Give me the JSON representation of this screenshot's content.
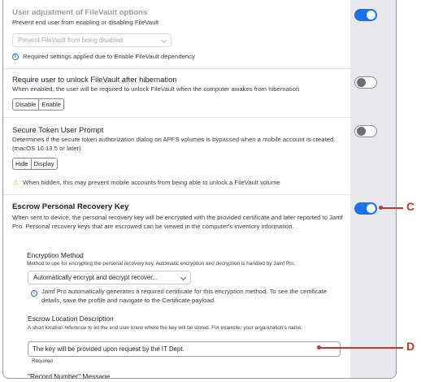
{
  "filevault_adjust": {
    "title": "User adjustment of FileVault options",
    "description": "Prevent end user from enabling or disabling FileVault",
    "select_value": "Prevent FileVault from being disabled",
    "note": "Required settings applied due to Enable FileVault dependency",
    "toggle": "on"
  },
  "unlock_hibernation": {
    "title": "Require user to unlock FileVault after hibernation",
    "description": "When enabled, the user will be required to unlock FileVault when the computer awakes from hibernation",
    "options": [
      "Disable",
      "Enable"
    ],
    "toggle": "off"
  },
  "secure_token": {
    "title": "Secure Token User Prompt",
    "description": "Determines if the secure token authorization dialog on APFS volumes is bypassed when a mobile account is created. (macOS 10.13.5 or later)",
    "options": [
      "Hide",
      "Display"
    ],
    "warning": "When hidden, this may prevent mobile accounts from being able to unlock a FileVault volume",
    "toggle": "off"
  },
  "escrow": {
    "title": "Escrow Personal Recovery Key",
    "description": "When sent to device, the personal recovery key will be encrypted with the provided certificate and later reported to Jamf Pro. Personal recovery keys that are escrowed can be viewed in the computer's inventory information.",
    "toggle": "on",
    "encryption": {
      "label": "Encryption Method",
      "help": "Method to use for encrypting the personal recovery key. Automatic encryption and decryption is handled by Jamf Pro.",
      "select_value": "Automatically encrypt and decrypt recover...",
      "note": "Jamf Pro automatically generates a required certificate for this encryption method. To see the certificate details, save the profile and navigate to the Certificate payload."
    },
    "location": {
      "label": "Escrow Location Description",
      "help": "A short location reference to let the end user know where the key will be stored. For example, your organization's name.",
      "value": "The key will be provided upon request by the IT Dept.",
      "required": "Required"
    },
    "record_label": "\"Record Number\" Message"
  },
  "callouts": {
    "c": "C",
    "d": "D"
  },
  "colors": {
    "accent": "#1a73e8",
    "callout": "#c0392b",
    "warning": "#e8a21a"
  },
  "icons": {
    "info": "info-icon",
    "warning": "warning-icon",
    "chevron": "chevron-down-icon"
  }
}
